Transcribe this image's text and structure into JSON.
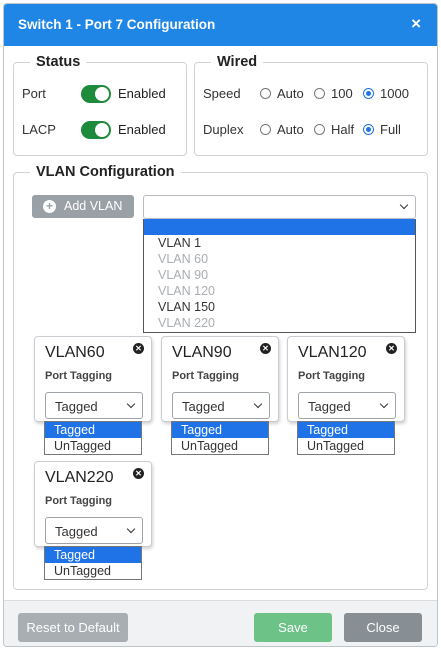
{
  "dialog": {
    "title": "Switch 1 - Port 7 Configuration",
    "close_glyph": "×"
  },
  "status": {
    "legend": "Status",
    "rows": [
      {
        "label": "Port",
        "state": "Enabled",
        "on": true
      },
      {
        "label": "LACP",
        "state": "Enabled",
        "on": true
      }
    ]
  },
  "wired": {
    "legend": "Wired",
    "speed": {
      "label": "Speed",
      "options": [
        "Auto",
        "100",
        "1000"
      ],
      "selected": "1000"
    },
    "duplex": {
      "label": "Duplex",
      "options": [
        "Auto",
        "Half",
        "Full"
      ],
      "selected": "Full"
    }
  },
  "vlan_config": {
    "legend": "VLAN Configuration",
    "add_button": "Add VLAN",
    "select_value": "",
    "options": [
      {
        "label": "VLAN 1",
        "enabled": true
      },
      {
        "label": "VLAN 60",
        "enabled": false
      },
      {
        "label": "VLAN 90",
        "enabled": false
      },
      {
        "label": "VLAN 120",
        "enabled": false
      },
      {
        "label": "VLAN 150",
        "enabled": true
      },
      {
        "label": "VLAN 220",
        "enabled": false
      }
    ],
    "cards": [
      {
        "name": "VLAN60",
        "sub": "Port Tagging",
        "value": "Tagged",
        "options": [
          "Tagged",
          "UnTagged"
        ]
      },
      {
        "name": "VLAN90",
        "sub": "Port Tagging",
        "value": "Tagged",
        "options": [
          "Tagged",
          "UnTagged"
        ]
      },
      {
        "name": "VLAN120",
        "sub": "Port Tagging",
        "value": "Tagged",
        "options": [
          "Tagged",
          "UnTagged"
        ]
      },
      {
        "name": "VLAN220",
        "sub": "Port Tagging",
        "value": "Tagged",
        "options": [
          "Tagged",
          "UnTagged"
        ]
      }
    ]
  },
  "footer": {
    "reset": "Reset to Default",
    "save": "Save",
    "close": "Close"
  },
  "colors": {
    "title_bar": "#1f86e6",
    "toggle_on": "#1e8a3c",
    "highlight": "#1f73e6",
    "save_button": "#6cc287",
    "close_button": "#878e94",
    "reset_button": "#a9aeb3",
    "add_button": "#9aa1a6"
  },
  "icons": {
    "close": "close-icon",
    "add": "plus-circle-icon",
    "chevron": "chevron-down-icon",
    "card_remove": "remove-circle-icon"
  }
}
